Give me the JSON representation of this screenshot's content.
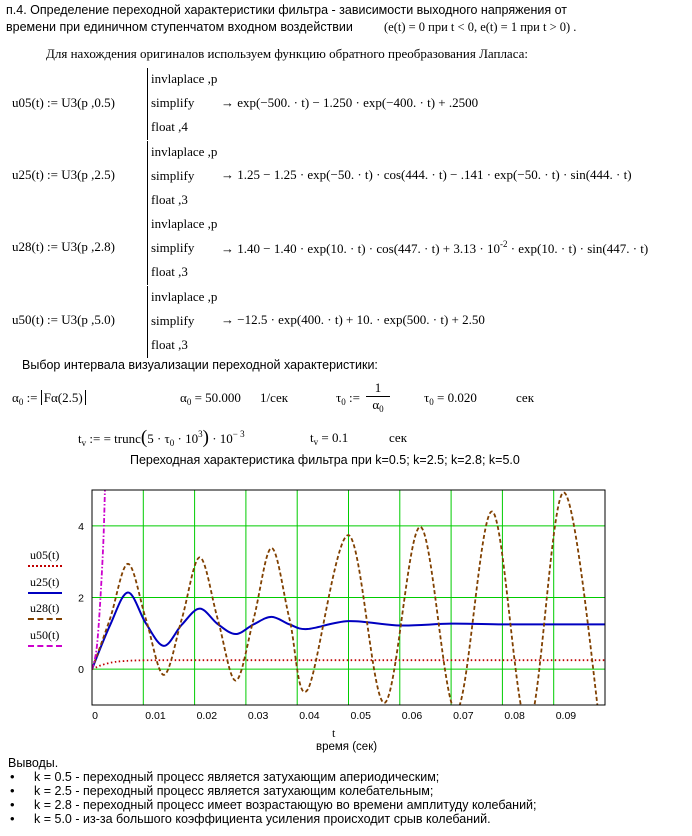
{
  "header": {
    "line1": "п.4. Определение   переходной характеристики фильтра     - зависимости выходного напряжения от",
    "line2": "времени при единичном ступенчатом входном воздействии",
    "line2_cond": "(e(t) = 0  при t < 0, e(t) = 1 при t > 0)  .",
    "intro": "Для нахождения оригиналов используем функцию обратного преобразования Лапласа:"
  },
  "ops": [
    "invlaplace ,p",
    "simplify",
    "float ,4",
    "float ,3"
  ],
  "defs": [
    {
      "lhs": "u05(t) := U3(p ,0.5)",
      "op1": "invlaplace ,p",
      "op2": "simplify",
      "op3": "float ,4",
      "result": "→ exp(−500. · t) − 1.250 · exp(−400. · t) + .2500"
    },
    {
      "lhs": "u25(t) := U3(p ,2.5)",
      "op1": "invlaplace ,p",
      "op2": "simplify",
      "op3": "float ,3",
      "result": "→ 1.25 − 1.25 · exp(−50. · t) · cos(444. · t) − .141 · exp(−50. · t) · sin(444. · t)"
    },
    {
      "lhs": "u28(t) := U3(p ,2.8)",
      "op1": "invlaplace ,p",
      "op2": "simplify",
      "op3": "float ,3",
      "result_a": "→ 1.40 − 1.40 · exp(10. · t) · cos(447. · t) + 3.13 · 10",
      "result_exp": "-2",
      "result_b": " · exp(10. · t) · sin(447. · t)"
    },
    {
      "lhs": "u50(t) := U3(p ,5.0)",
      "op1": "invlaplace ,p",
      "op2": "simplify",
      "op3": "float ,3",
      "result": "→ −12.5 · exp(400. · t) + 10. · exp(500. · t) + 2.50"
    }
  ],
  "interval": {
    "heading": "Выбор интервала визуализации переходной характеристики:",
    "alpha_def": "Fα(2.5)",
    "alpha_val": "= 50.000",
    "alpha_unit": "1/сек",
    "tau_num": "1",
    "tau_val": "= 0.020",
    "tau_unit": "сек",
    "tv_expr_a": "= trunc",
    "tv_expr_b": "5 · τ",
    "tv_expr_c": " · 10",
    "tv_exp3": "3",
    "tv_expr_d": " · 10",
    "tv_expm3": "− 3",
    "tv_val": "= 0.1",
    "tv_unit": "сек"
  },
  "plot": {
    "title": "Переходная характеристика фильтра при k=0.5; k=2.5; k=2.8; k=5.0",
    "xlabel_var": "t",
    "xlabel": "время (сек)"
  },
  "chart_data": {
    "type": "line",
    "title": "Переходная характеристика фильтра при k=0.5; k=2.5; k=2.8; k=5.0",
    "xlabel": "время (сек)",
    "xlim": [
      0,
      0.1
    ],
    "ylim": [
      -1,
      5
    ],
    "xticks": [
      "0",
      "0.01",
      "0.02",
      "0.03",
      "0.04",
      "0.05",
      "0.06",
      "0.07",
      "0.08",
      "0.09"
    ],
    "yticks": [
      "0",
      "2",
      "4"
    ],
    "grid": true,
    "legend_position": "left",
    "series": [
      {
        "name": "u05(t)",
        "color": "#c00000",
        "style": "dotted",
        "x": [
          0,
          0.001,
          0.002,
          0.004,
          0.006,
          0.01,
          0.02,
          0.05,
          0.1
        ],
        "y": [
          0,
          0.062,
          0.121,
          0.191,
          0.224,
          0.247,
          0.25,
          0.25,
          0.25
        ]
      },
      {
        "name": "u25(t)",
        "color": "#0000c0",
        "style": "solid",
        "x": [
          0,
          0.0035,
          0.007,
          0.0105,
          0.014,
          0.0175,
          0.021,
          0.0245,
          0.028,
          0.0315,
          0.035,
          0.0385,
          0.042,
          0.05,
          0.06,
          0.07,
          0.08,
          0.09,
          0.1
        ],
        "y": [
          0,
          1.22,
          2.14,
          1.28,
          0.65,
          1.24,
          1.69,
          1.26,
          0.98,
          1.25,
          1.46,
          1.25,
          1.12,
          1.34,
          1.22,
          1.27,
          1.25,
          1.25,
          1.25
        ]
      },
      {
        "name": "u28(t)",
        "color": "#804000",
        "style": "dashed",
        "x": [
          0,
          0.0035,
          0.007,
          0.0105,
          0.014,
          0.0175,
          0.021,
          0.0245,
          0.028,
          0.0315,
          0.035,
          0.0385,
          0.042,
          0.05,
          0.057,
          0.064,
          0.071,
          0.078,
          0.085,
          0.092,
          0.0995
        ],
        "y": [
          0,
          1.4,
          2.94,
          1.4,
          -0.16,
          1.4,
          3.12,
          1.4,
          -0.32,
          1.4,
          3.38,
          1.4,
          -0.58,
          3.74,
          -0.94,
          3.97,
          -1.17,
          4.4,
          -1.6,
          4.93,
          -2.13
        ]
      },
      {
        "name": "u50(t)",
        "color": "#cc00cc",
        "style": "dashdot",
        "x": [
          0,
          0.001,
          0.002,
          0.0025,
          0.003
        ],
        "y": [
          0,
          0.7,
          2.9,
          4.9,
          8.5
        ]
      }
    ]
  },
  "conclusions": {
    "title": "Выводы.",
    "items": [
      "k = 0.5  -  переходный процесс является затухающим апериодическим;",
      "k = 2.5  -  переходный процесс является затухающим колебательным;",
      "k = 2.8  -  переходный процесс имеет возрастающую во времени амплитуду колебаний;",
      "k = 5.0  -  из-за большого коэффициента усиления происходит срыв колебаний."
    ]
  }
}
